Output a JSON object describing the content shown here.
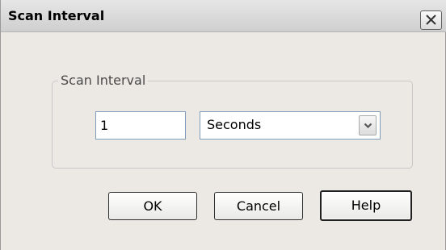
{
  "window": {
    "title": "Scan Interval"
  },
  "group": {
    "legend": "Scan Interval"
  },
  "interval": {
    "value": "1"
  },
  "unit_select": {
    "selected": "Seconds"
  },
  "buttons": {
    "ok": "OK",
    "cancel": "Cancel",
    "help": "Help"
  },
  "icons": {
    "close": "close-icon",
    "dropdown": "chevron-down-icon"
  },
  "colors": {
    "dialog_background": "#ece9e4",
    "field_border": "#7f9db9"
  }
}
